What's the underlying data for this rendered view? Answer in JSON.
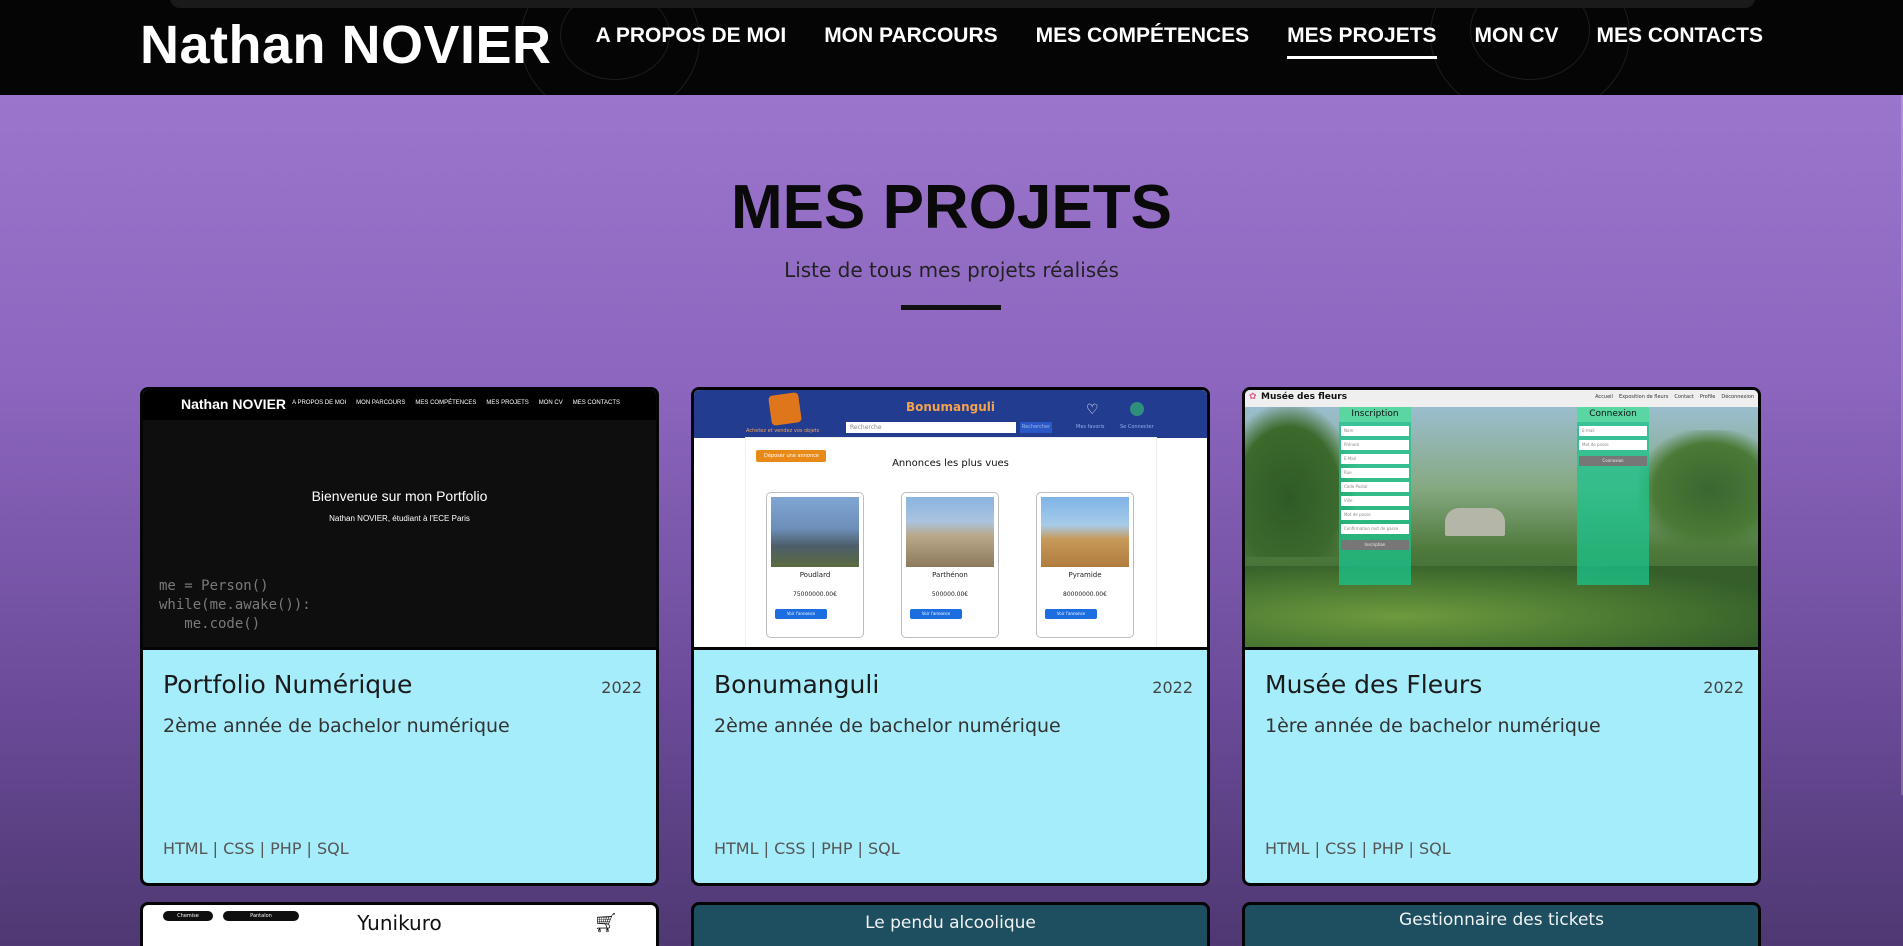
{
  "header": {
    "site_title": "Nathan NOVIER",
    "nav": [
      {
        "label": "A PROPOS DE MOI",
        "active": false
      },
      {
        "label": "MON PARCOURS",
        "active": false
      },
      {
        "label": "MES COMPÉTENCES",
        "active": false
      },
      {
        "label": "MES PROJETS",
        "active": true
      },
      {
        "label": "MON CV",
        "active": false
      },
      {
        "label": "MES CONTACTS",
        "active": false
      }
    ]
  },
  "section": {
    "title": "MES PROJETS",
    "subtitle": "Liste de tous mes projets réalisés"
  },
  "projects": [
    {
      "name": "Portfolio Numérique",
      "year": "2022",
      "description": "2ème année de bachelor numérique",
      "tags": "HTML | CSS | PHP | SQL",
      "thumbnail": {
        "title": "Nathan NOVIER",
        "nav": [
          "A PROPOS DE MOI",
          "MON PARCOURS",
          "MES COMPÉTENCES",
          "MES PROJETS",
          "MON CV",
          "MES CONTACTS"
        ],
        "welcome": "Bienvenue sur mon Portfolio",
        "welcome_sub": "Nathan NOVIER, étudiant à l'ECE Paris",
        "code": "me = Person()\nwhile(me.awake()):\n   me.code()"
      }
    },
    {
      "name": "Bonumanguli",
      "year": "2022",
      "description": "2ème année de bachelor numérique",
      "tags": "HTML | CSS | PHP | SQL",
      "thumbnail": {
        "site_name": "Bonumanguli",
        "tagline": "Achetez et vendez vos objets",
        "search_placeholder": "Recherche",
        "search_button": "Rechercher",
        "favorites": "Mes favoris",
        "connection": "Se Connecter",
        "post_button": "Déposer une annonce",
        "heading": "Annonces les plus vues",
        "items": [
          {
            "label": "Poudlard",
            "price": "75000000.00€",
            "button": "Voir l'annonce",
            "color": "#6d8fb8"
          },
          {
            "label": "Parthénon",
            "price": "500000.00€",
            "button": "Voir l'annonce",
            "color": "#b9a98a"
          },
          {
            "label": "Pyramide",
            "price": "80000000.00€",
            "button": "Voir l'annonce",
            "color": "#c79a5a"
          }
        ]
      }
    },
    {
      "name": "Musée des Fleurs",
      "year": "2022",
      "description": "1ère année de bachelor numérique",
      "tags": "HTML | CSS | PHP | SQL",
      "thumbnail": {
        "site_name": "Musée des fleurs",
        "links": [
          "Accueil",
          "Exposition de fleurs",
          "Contact",
          "Profile",
          "Déconnexion"
        ],
        "signup_title": "Inscription",
        "signup_fields": [
          "Nom",
          "Prénom",
          "E-Mail",
          "Rue",
          "Code Postal",
          "Ville",
          "Mot de passe",
          "Confirmation mot de passe"
        ],
        "signup_button": "Inscription",
        "login_title": "Connexion",
        "login_fields": [
          "E-mail",
          "Mot de passe"
        ],
        "login_button": "Connexion"
      }
    }
  ],
  "partial_projects": [
    {
      "title": "Yunikuro",
      "pills": [
        "Chemise",
        "Pantalon"
      ]
    },
    {
      "title": "Le pendu alcoolique"
    },
    {
      "title": "Gestionnaire des tickets"
    }
  ]
}
